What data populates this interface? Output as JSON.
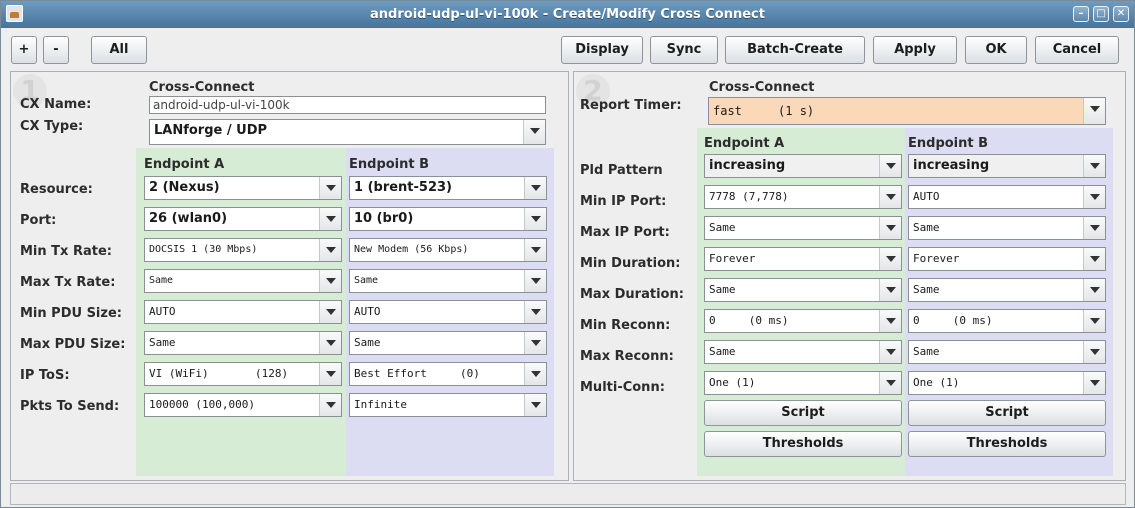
{
  "window": {
    "title": "android-udp-ul-vi-100k - Create/Modify Cross Connect",
    "controls": [
      "minimize-icon",
      "maximize-icon",
      "close-icon"
    ]
  },
  "toolbar": {
    "plus_label": "+",
    "minus_label": "-",
    "all_label": "All",
    "display_label": "Display",
    "sync_label": "Sync",
    "batch_create_label": "Batch-Create",
    "apply_label": "Apply",
    "ok_label": "OK",
    "cancel_label": "Cancel"
  },
  "left": {
    "badge": "1",
    "section_title": "Cross-Connect",
    "cx_name_label": "CX Name:",
    "cx_name_value": "android-udp-ul-vi-100k",
    "cx_type_label": "CX Type:",
    "cx_type_value": "LANforge / UDP",
    "endpoint_a_header": "Endpoint A",
    "endpoint_b_header": "Endpoint B",
    "rows": [
      {
        "label": "Resource:",
        "a": "2 (Nexus)",
        "b": "1 (brent-523)"
      },
      {
        "label": "Port:",
        "a": "26 (wlan0)",
        "b": "10 (br0)"
      },
      {
        "label": "Min Tx Rate:",
        "a": "DOCSIS 1 (30 Mbps)",
        "b": "New Modem (56 Kbps)"
      },
      {
        "label": "Max Tx Rate:",
        "a": "Same",
        "b": "Same"
      },
      {
        "label": "Min PDU Size:",
        "a": "AUTO",
        "b": "AUTO"
      },
      {
        "label": "Max PDU Size:",
        "a": "Same",
        "b": "Same"
      },
      {
        "label": "IP ToS:",
        "a": "VI (WiFi)       (128)",
        "b": "Best Effort     (0)"
      },
      {
        "label": "Pkts To Send:",
        "a": "100000 (100,000)",
        "b": "Infinite"
      }
    ]
  },
  "right": {
    "badge": "2",
    "section_title": "Cross-Connect",
    "report_timer_label": "Report Timer:",
    "report_timer_value": "fast     (1 s)",
    "endpoint_a_header": "Endpoint A",
    "endpoint_b_header": "Endpoint B",
    "rows": [
      {
        "label": "Pld Pattern",
        "a": "increasing",
        "b": "increasing"
      },
      {
        "label": "Min IP Port:",
        "a": "7778 (7,778)",
        "b": "AUTO"
      },
      {
        "label": "Max IP Port:",
        "a": "Same",
        "b": "Same"
      },
      {
        "label": "Min Duration:",
        "a": "Forever",
        "b": "Forever"
      },
      {
        "label": "Max Duration:",
        "a": "Same",
        "b": "Same"
      },
      {
        "label": "Min Reconn:",
        "a": "0     (0 ms)",
        "b": "0     (0 ms)"
      },
      {
        "label": "Max Reconn:",
        "a": "Same",
        "b": "Same"
      },
      {
        "label": "Multi-Conn:",
        "a": "One (1)",
        "b": "One (1)"
      }
    ],
    "script_label": "Script",
    "thresholds_label": "Thresholds"
  },
  "colors": {
    "endpoint_a_bg": "#d7ecd4",
    "endpoint_b_bg": "#dcdcf2",
    "report_timer_bg": "#fbd9b8",
    "titlebar": "#5a87ad"
  }
}
